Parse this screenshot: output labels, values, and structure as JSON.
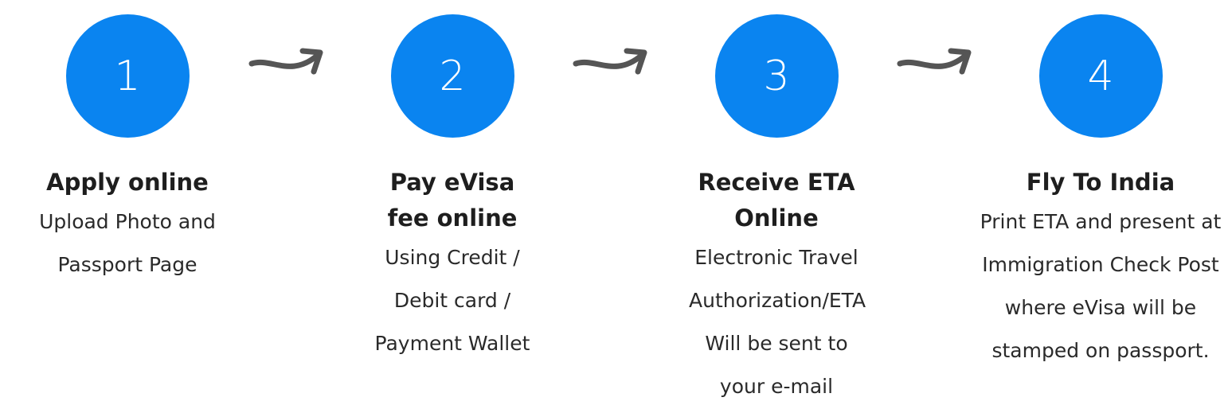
{
  "colors": {
    "circle": "#0a84f0",
    "arrow": "#555555"
  },
  "steps": [
    {
      "number": "1",
      "title": "Apply online",
      "description": "Upload Photo and Passport Page"
    },
    {
      "number": "2",
      "title": "Pay eVisa fee online",
      "description": "Using Credit / Debit card / Payment Wallet"
    },
    {
      "number": "3",
      "title": "Receive ETA Online",
      "description": "Electronic Travel Authorization/ETA Will be sent to your e-mail"
    },
    {
      "number": "4",
      "title": "Fly To India",
      "description": "Print ETA and present at Immigration Check Post where eVisa will be stamped on passport."
    }
  ]
}
